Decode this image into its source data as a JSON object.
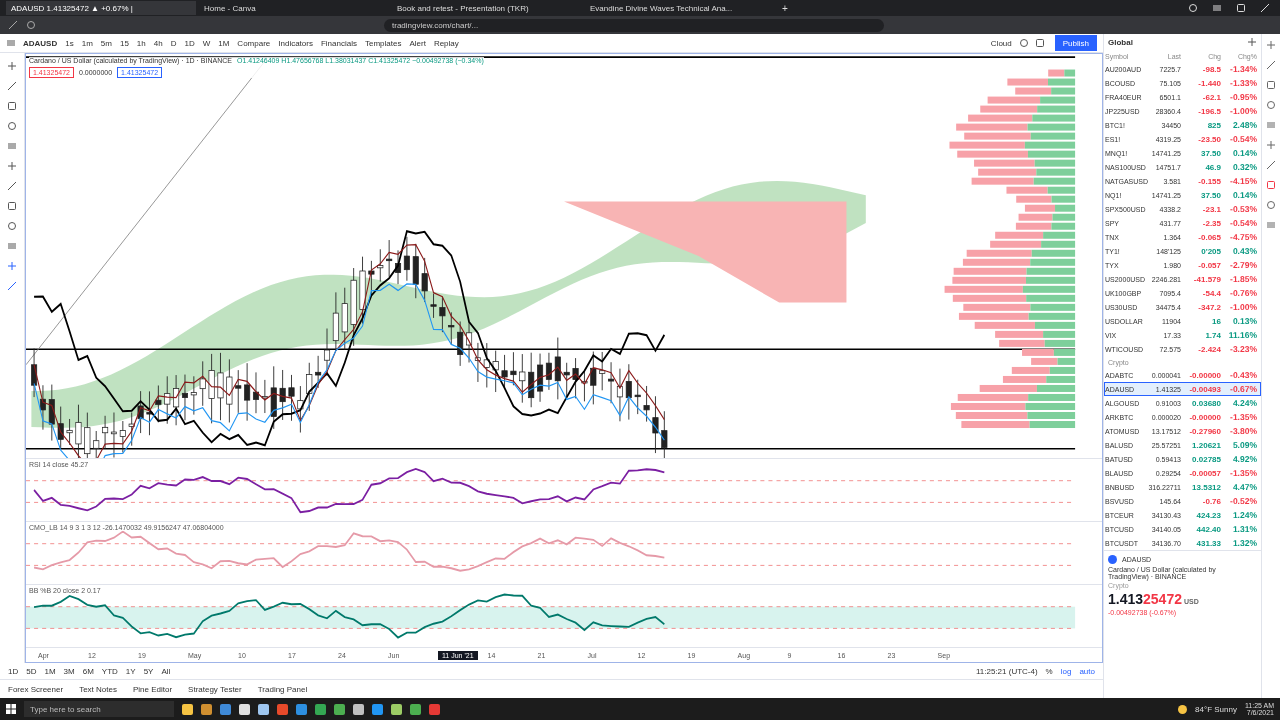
{
  "browser": {
    "tabs": [
      {
        "title": "ADAUSD 1.41325472 ▲ +0.67% |",
        "selected": true
      },
      {
        "title": "Home - Canva",
        "selected": false
      },
      {
        "title": "Book and retest - Presentation (TKR)",
        "selected": false
      },
      {
        "title": "Evandine Divine Waves Technical Ana...",
        "selected": false
      }
    ],
    "new_tab": "+",
    "address": "tradingview.com/chart/..."
  },
  "toolbar": {
    "symbol": "ADAUSD",
    "intervals": [
      "1s",
      "1m",
      "5m",
      "15",
      "1h",
      "4h",
      "D",
      "1D",
      "W",
      "1M"
    ],
    "buttons": [
      "Compare",
      "Indicators",
      "Financials",
      "Templates",
      "Alert",
      "Replay"
    ],
    "layout": "Cloud",
    "publish": "Publish"
  },
  "chart": {
    "title": "Cardano / US Dollar (calculated by TradingView) · 1D · BINANCE",
    "ohlc": "O1.41246409 H1.47656768 L1.38031437 C1.41325472 −0.00492738 (−0.34%)",
    "sell": "1.41325472",
    "spread": "0.0000000",
    "buy": "1.41325472",
    "studies": [
      "RSI 14 close 45.27",
      "CMO_LB 14 9 3 1 3 12 -26.1470032 49.9156247 47.06804000",
      "BB %B 20 close 2 0.17"
    ],
    "time_labels": [
      "Apr",
      "12",
      "19",
      "May",
      "10",
      "17",
      "24",
      "Jun",
      "14",
      "21",
      "Jul",
      "12",
      "19",
      "Aug",
      "9",
      "16",
      "23",
      "Sep"
    ],
    "cursor_date": "11 Jun '21"
  },
  "bottom": {
    "ranges": [
      "1D",
      "5D",
      "1M",
      "3M",
      "6M",
      "YTD",
      "1Y",
      "5Y",
      "All"
    ],
    "clock": "11:25:21 (UTC-4)",
    "scale": [
      "%",
      "log",
      "auto"
    ],
    "panels": [
      "Forex Screener",
      "Text Notes",
      "Pine Editor",
      "Strategy Tester",
      "Trading Panel"
    ]
  },
  "watchlist": {
    "name": "Global",
    "columns": [
      "Symbol",
      "Last",
      "Chg",
      "Chg%"
    ],
    "sections": [
      {
        "rows": [
          {
            "symbol": "AU200AUD",
            "last": "7225.7",
            "chg": "-98.5",
            "pct": "-1.34%",
            "color": "#f23645",
            "selected": false
          },
          {
            "symbol": "BCOUSD",
            "last": "75.105",
            "chg": "-1.440",
            "pct": "-1.33%",
            "color": "#f23645",
            "selected": false
          },
          {
            "symbol": "FRA40EUR",
            "last": "6501.1",
            "chg": "-62.1",
            "pct": "-0.95%",
            "color": "#f23645",
            "selected": false
          },
          {
            "symbol": "JP225USD",
            "last": "28360.4",
            "chg": "-196.5",
            "pct": "-1.00%",
            "color": "#f23645",
            "selected": false
          },
          {
            "symbol": "BTC1!",
            "last": "34450",
            "chg": "825",
            "pct": "2.48%",
            "color": "#089981",
            "selected": false
          },
          {
            "symbol": "ES1!",
            "last": "4319.25",
            "chg": "-23.50",
            "pct": "-0.54%",
            "color": "#f23645",
            "selected": false
          },
          {
            "symbol": "MNQ1!",
            "last": "14741.25",
            "chg": "37.50",
            "pct": "0.14%",
            "color": "#089981",
            "selected": false
          },
          {
            "symbol": "NAS100USD",
            "last": "14751.7",
            "chg": "46.9",
            "pct": "0.32%",
            "color": "#089981",
            "selected": false
          },
          {
            "symbol": "NATGASUSD",
            "last": "3.581",
            "chg": "-0.155",
            "pct": "-4.15%",
            "color": "#f23645",
            "selected": false
          },
          {
            "symbol": "NQ1!",
            "last": "14741.25",
            "chg": "37.50",
            "pct": "0.14%",
            "color": "#089981",
            "selected": false
          },
          {
            "symbol": "SPX500USD",
            "last": "4338.2",
            "chg": "-23.1",
            "pct": "-0.53%",
            "color": "#f23645",
            "selected": false
          },
          {
            "symbol": "SPY",
            "last": "431.77",
            "chg": "-2.35",
            "pct": "-0.54%",
            "color": "#f23645",
            "selected": false
          },
          {
            "symbol": "TNX",
            "last": "1.364",
            "chg": "-0.065",
            "pct": "-4.75%",
            "color": "#f23645",
            "selected": false
          },
          {
            "symbol": "TY1!",
            "last": "148'125",
            "chg": "0'205",
            "pct": "0.43%",
            "color": "#089981",
            "selected": false
          },
          {
            "symbol": "TYX",
            "last": "1.980",
            "chg": "-0.057",
            "pct": "-2.79%",
            "color": "#f23645",
            "selected": false
          },
          {
            "symbol": "US2000USD",
            "last": "2246.281",
            "chg": "-41.579",
            "pct": "-1.85%",
            "color": "#f23645",
            "selected": false
          },
          {
            "symbol": "UK100GBP",
            "last": "7095.4",
            "chg": "-54.4",
            "pct": "-0.76%",
            "color": "#f23645",
            "selected": false
          },
          {
            "symbol": "US30USD",
            "last": "34475.4",
            "chg": "-347.2",
            "pct": "-1.00%",
            "color": "#f23645",
            "selected": false
          },
          {
            "symbol": "USDOLLAR",
            "last": "11904",
            "chg": "16",
            "pct": "0.13%",
            "color": "#089981",
            "selected": false
          },
          {
            "symbol": "VIX",
            "last": "17.33",
            "chg": "1.74",
            "pct": "11.16%",
            "color": "#089981",
            "selected": false
          },
          {
            "symbol": "WTICOUSD",
            "last": "72.575",
            "chg": "-2.424",
            "pct": "-3.23%",
            "color": "#f23645",
            "selected": false
          }
        ]
      },
      {
        "title": "Crypto",
        "rows": [
          {
            "symbol": "ADABTC",
            "last": "0.000041",
            "chg": "-0.00000",
            "pct": "-0.43%",
            "color": "#f23645",
            "selected": false
          },
          {
            "symbol": "ADAUSD",
            "last": "1.41325",
            "chg": "-0.00493",
            "pct": "-0.67%",
            "color": "#f23645",
            "selected": true
          },
          {
            "symbol": "ALGOUSD",
            "last": "0.91003",
            "chg": "0.03680",
            "pct": "4.24%",
            "color": "#089981",
            "selected": false
          },
          {
            "symbol": "ARKBTC",
            "last": "0.000020",
            "chg": "-0.00000",
            "pct": "-1.35%",
            "color": "#f23645",
            "selected": false
          },
          {
            "symbol": "ATOMUSD",
            "last": "13.17512",
            "chg": "-0.27960",
            "pct": "-3.80%",
            "color": "#f23645",
            "selected": false
          },
          {
            "symbol": "BALUSD",
            "last": "25.57251",
            "chg": "1.20621",
            "pct": "5.09%",
            "color": "#089981",
            "selected": false
          },
          {
            "symbol": "BATUSD",
            "last": "0.59413",
            "chg": "0.02785",
            "pct": "4.92%",
            "color": "#089981",
            "selected": false
          },
          {
            "symbol": "BLAUSD",
            "last": "0.29254",
            "chg": "-0.00057",
            "pct": "-1.35%",
            "color": "#f23645",
            "selected": false
          },
          {
            "symbol": "BNBUSD",
            "last": "316.22711",
            "chg": "13.5312",
            "pct": "4.47%",
            "color": "#089981",
            "selected": false
          },
          {
            "symbol": "BSVUSD",
            "last": "145.64",
            "chg": "-0.76",
            "pct": "-0.52%",
            "color": "#f23645",
            "selected": false
          },
          {
            "symbol": "BTCEUR",
            "last": "34130.43",
            "chg": "424.23",
            "pct": "1.24%",
            "color": "#089981",
            "selected": false
          },
          {
            "symbol": "BTCUSD",
            "last": "34140.05",
            "chg": "442.40",
            "pct": "1.31%",
            "color": "#089981",
            "selected": false
          },
          {
            "symbol": "BTCUSDT",
            "last": "34136.70",
            "chg": "431.33",
            "pct": "1.32%",
            "color": "#089981",
            "selected": false
          }
        ]
      }
    ],
    "detail": {
      "symbol": "ADAUSD",
      "name": "Cardano / US Dollar (calculated by TradingView) · BINANCE",
      "type": "Crypto",
      "price_main": "1.413",
      "price_tail": "25472",
      "currency": "USD",
      "change": "-0.00492738 (-0.67%)"
    }
  },
  "taskbar": {
    "search": "Type here to search",
    "weather": "84°F Sunny",
    "time": "11:25 AM",
    "date": "7/6/2021"
  }
}
